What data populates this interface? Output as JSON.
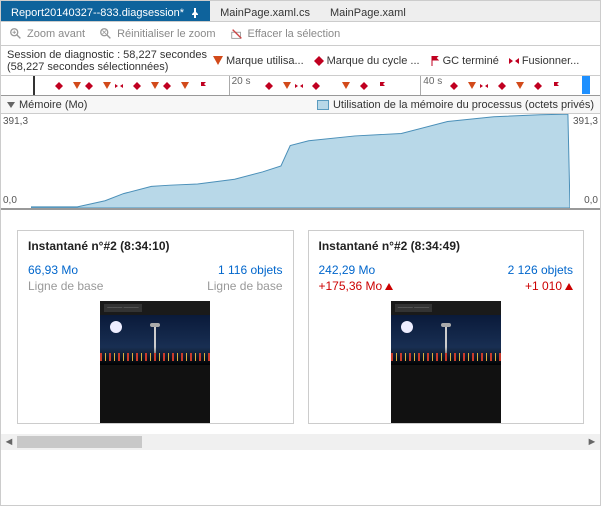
{
  "tabs": [
    {
      "label": "Report20140327--833.diagsession*",
      "active": true
    },
    {
      "label": "MainPage.xaml.cs",
      "active": false
    },
    {
      "label": "MainPage.xaml",
      "active": false
    }
  ],
  "toolbar": {
    "zoom_in": "Zoom avant",
    "reset_zoom": "Réinitialiser le zoom",
    "clear_sel": "Effacer la sélection"
  },
  "session": {
    "line1": "Session de diagnostic : 58,227 secondes",
    "line2": "(58,227 secondes sélectionnées)"
  },
  "legend": {
    "user_mark": "Marque utilisa...",
    "cycle_mark": "Marque du cycle ...",
    "gc_done": "GC terminé",
    "merge": "Fusionner..."
  },
  "ruler": {
    "t1": "20 s",
    "t2": "40 s"
  },
  "chart": {
    "title": "Mémoire (Mo)",
    "series_label": "Utilisation de la mémoire du processus (octets privés)",
    "ymax": "391,3",
    "ymin": "0,0"
  },
  "chart_data": {
    "type": "area",
    "xlabel": "s",
    "ylabel": "Mo",
    "ylim": [
      0,
      391.3
    ],
    "xlim": [
      0,
      58.227
    ],
    "x": [
      0,
      5,
      8,
      10,
      13,
      15,
      18,
      22,
      25,
      27,
      28,
      30,
      35,
      40,
      45,
      50,
      55,
      58
    ],
    "values": [
      5,
      5,
      30,
      60,
      90,
      95,
      100,
      120,
      150,
      175,
      260,
      280,
      300,
      310,
      360,
      380,
      388,
      391
    ]
  },
  "snapshots": [
    {
      "title": "Instantané n°#2 (8:34:10)",
      "size": "66,93 Mo",
      "objects": "1 116 objets",
      "baseline_l": "Ligne de base",
      "baseline_r": "Ligne de base",
      "delta_size": "",
      "delta_obj": ""
    },
    {
      "title": "Instantané n°#2 (8:34:49)",
      "size": "242,29 Mo",
      "objects": "2 126 objets",
      "baseline_l": "",
      "baseline_r": "",
      "delta_size": "+175,36 Mo",
      "delta_obj": "+1 010"
    }
  ],
  "colors": {
    "accent": "#0e639c",
    "link": "#0066cc",
    "delta": "#c00020"
  }
}
